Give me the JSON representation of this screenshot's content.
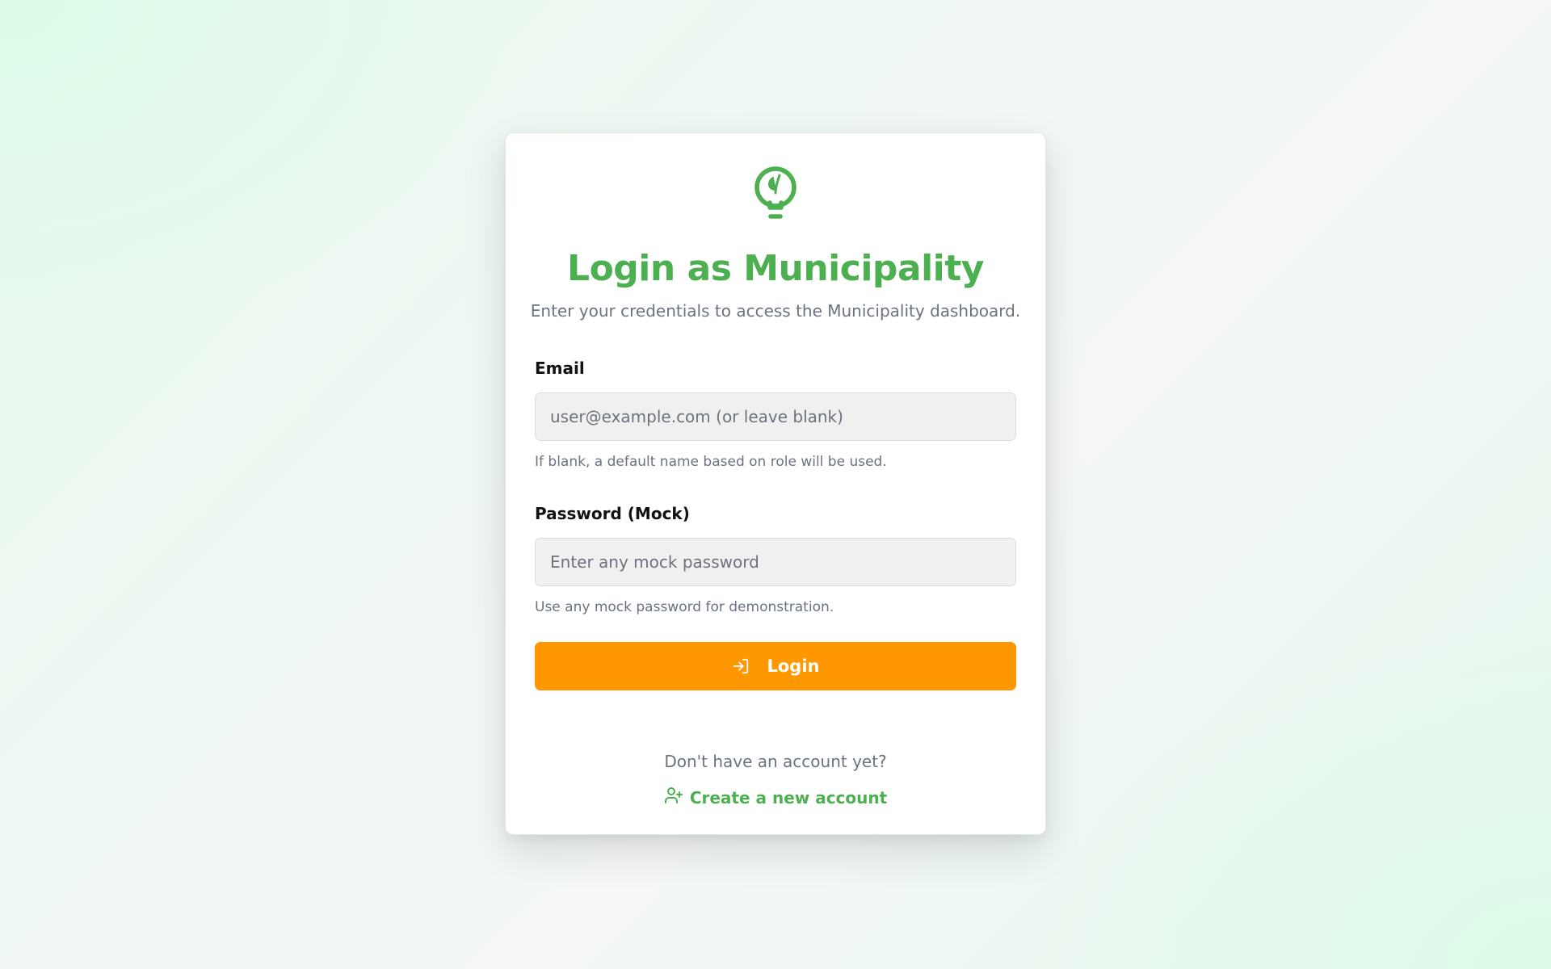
{
  "brand": {
    "logo_icon": "lightbulb-leaf-icon",
    "accent_color": "#4caf50",
    "action_color": "#ff9800"
  },
  "login": {
    "title": "Login as Municipality",
    "subtitle": "Enter your credentials to access the Municipality dashboard."
  },
  "email": {
    "label": "Email",
    "value": "",
    "placeholder": "user@example.com (or leave blank)",
    "hint": "If blank, a default name based on role will be used."
  },
  "password": {
    "label": "Password (Mock)",
    "value": "",
    "placeholder": "Enter any mock password",
    "hint": "Use any mock password for demonstration."
  },
  "login_button": {
    "label": "Login",
    "icon": "log-in-icon"
  },
  "signup": {
    "prompt": "Don't have an account yet?",
    "link_label": "Create a new account",
    "icon": "user-plus-icon"
  }
}
